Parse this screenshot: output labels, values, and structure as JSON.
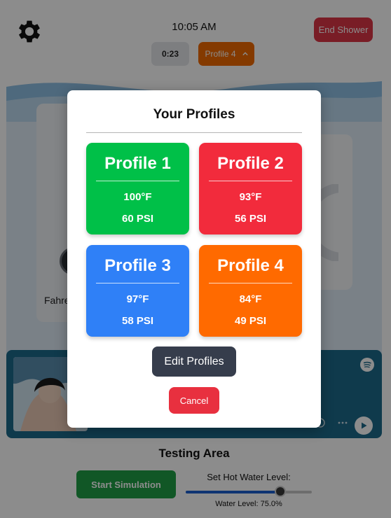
{
  "header": {
    "time": "10:05 AM",
    "end_label": "End Shower",
    "timer": "0:23",
    "active_profile": "Profile 4"
  },
  "background": {
    "temp_unit_label": "Fahre"
  },
  "testing": {
    "title": "Testing Area",
    "sim_label": "Start Simulation",
    "slider_label": "Set Hot Water Level:",
    "slider_value": 0.75,
    "readout": "Water Level: 75.0%"
  },
  "modal": {
    "title": "Your Profiles",
    "profiles": [
      {
        "name": "Profile 1",
        "temp": "100°F",
        "psi": "60 PSI",
        "color": "#00c048"
      },
      {
        "name": "Profile 2",
        "temp": "93°F",
        "psi": "56 PSI",
        "color": "#f22b3c"
      },
      {
        "name": "Profile 3",
        "temp": "97°F",
        "psi": "58 PSI",
        "color": "#2f80f7"
      },
      {
        "name": "Profile 4",
        "temp": "84°F",
        "psi": "49 PSI",
        "color": "#ff6a00"
      }
    ],
    "edit_label": "Edit Profiles",
    "cancel_label": "Cancel"
  },
  "icons": {
    "settings": "gear-icon",
    "caret": "chevron-up-icon",
    "spotify": "spotify-icon",
    "play": "play-icon"
  }
}
